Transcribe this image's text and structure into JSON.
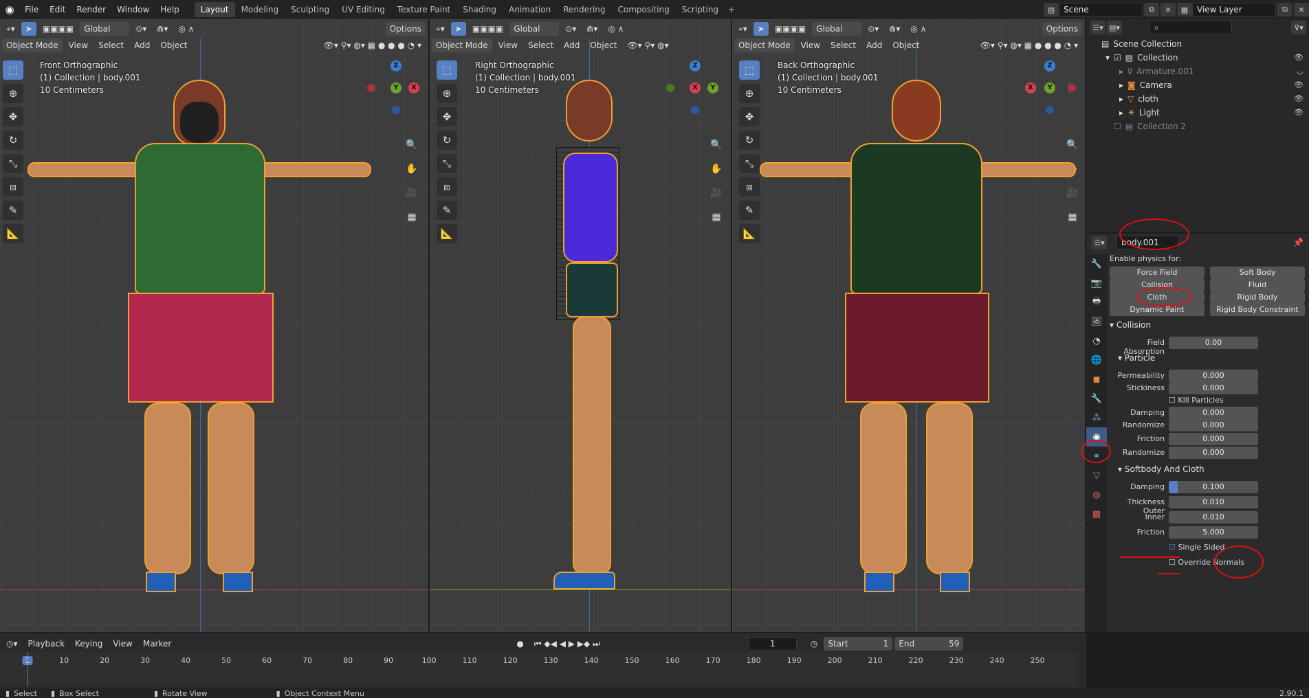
{
  "menu": [
    "File",
    "Edit",
    "Render",
    "Window",
    "Help"
  ],
  "workspaces": [
    "Layout",
    "Modeling",
    "Sculpting",
    "UV Editing",
    "Texture Paint",
    "Shading",
    "Animation",
    "Rendering",
    "Compositing",
    "Scripting"
  ],
  "active_workspace": "Layout",
  "scene": {
    "label": "Scene",
    "view_layer": "View Layer"
  },
  "viewport_header": {
    "mode": "Object Mode",
    "menus": [
      "View",
      "Select",
      "Add",
      "Object"
    ],
    "transform": "Global",
    "options": "Options"
  },
  "viewports": [
    {
      "view": "Front Orthographic",
      "collection": "(1) Collection | body.001",
      "scale": "10 Centimeters"
    },
    {
      "view": "Right Orthographic",
      "collection": "(1) Collection | body.001",
      "scale": "10 Centimeters"
    },
    {
      "view": "Back Orthographic",
      "collection": "(1) Collection | body.001",
      "scale": "10 Centimeters"
    }
  ],
  "outliner": {
    "search_placeholder": "",
    "items": [
      {
        "label": "Scene Collection",
        "level": 0
      },
      {
        "label": "Collection",
        "level": 1
      },
      {
        "label": "Armature.001",
        "level": 2
      },
      {
        "label": "Camera",
        "level": 2
      },
      {
        "label": "cloth",
        "level": 2
      },
      {
        "label": "Light",
        "level": 2
      },
      {
        "label": "Collection 2",
        "level": 1
      }
    ]
  },
  "properties": {
    "object_name": "body.001",
    "enable_physics_label": "Enable physics for:",
    "physics_buttons": [
      "Force Field",
      "Soft Body",
      "Collision",
      "Fluid",
      "Cloth",
      "Rigid Body",
      "Dynamic Paint",
      "Rigid Body Constraint"
    ],
    "collision_header": "Collision",
    "field_absorption": {
      "label": "Field Absorption",
      "value": "0.00"
    },
    "particle_header": "Particle",
    "particle": [
      {
        "label": "Permeability",
        "value": "0.000"
      },
      {
        "label": "Stickiness",
        "value": "0.000"
      },
      {
        "label": "Kill Particles",
        "value": ""
      },
      {
        "label": "Damping",
        "value": "0.000"
      },
      {
        "label": "Randomize",
        "value": "0.000"
      },
      {
        "label": "Friction",
        "value": "0.000"
      },
      {
        "label": "Randomize",
        "value": "0.000"
      }
    ],
    "softbody_header": "Softbody And Cloth",
    "softbody": [
      {
        "label": "Damping",
        "value": "0.100"
      },
      {
        "label": "Thickness Outer",
        "value": "0.010"
      },
      {
        "label": "Inner",
        "value": "0.010"
      },
      {
        "label": "Friction",
        "value": "5.000"
      }
    ],
    "single_sided": "Single Sided",
    "override_normals": "Override Normals"
  },
  "timeline": {
    "menus": [
      "Playback",
      "Keying",
      "View",
      "Marker"
    ],
    "current_frame": "1",
    "start_label": "Start",
    "start": "1",
    "end_label": "End",
    "end": "59",
    "ticks": [
      "1",
      "10",
      "20",
      "30",
      "40",
      "50",
      "60",
      "70",
      "80",
      "90",
      "100",
      "110",
      "120",
      "130",
      "140",
      "150",
      "160",
      "170",
      "180",
      "190",
      "200",
      "210",
      "220",
      "230",
      "240",
      "250"
    ]
  },
  "status": {
    "select": "Select",
    "box_select": "Box Select",
    "rotate_view": "Rotate View",
    "context_menu": "Object Context Menu",
    "version": "2.90.1"
  },
  "colors": {
    "accent": "#5680c2",
    "annotation": "#e01010",
    "shirt": "#2e6b33",
    "skirt": "#b2284e",
    "skin": "#c98a5a",
    "selection": "#f0a030"
  }
}
